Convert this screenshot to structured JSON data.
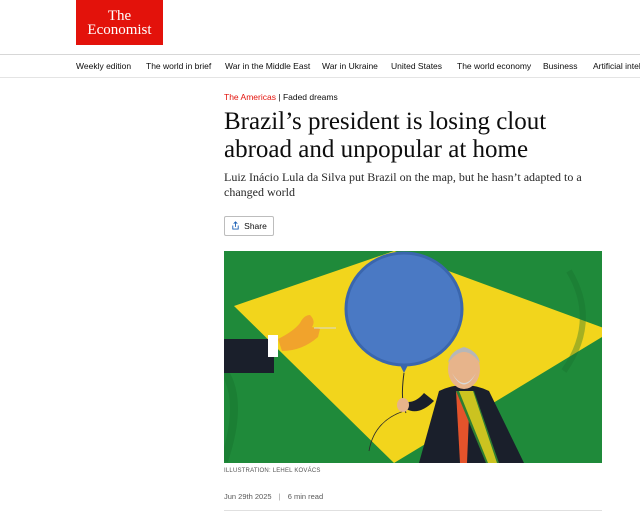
{
  "brand": {
    "line1": "The",
    "line2": "Economist",
    "color": "#e3120b"
  },
  "nav": {
    "items": [
      "Weekly edition",
      "The world in brief",
      "War in the Middle East",
      "War in Ukraine",
      "United States",
      "The world economy",
      "Business",
      "Artificial intel"
    ]
  },
  "article": {
    "section": "The Americas",
    "separator": "|",
    "fly_title": "Faded dreams",
    "headline": "Brazil’s president is losing clout abroad and unpopular at home",
    "subheadline": "Luiz Inácio Lula da Silva put Brazil on the map, but he hasn’t adapted to a changed world",
    "share_label": "Share",
    "share_icon": "share-icon",
    "image_caption": "ILLUSTRATION: LEHEL KOVÁCS",
    "date": "Jun 29th 2025",
    "meta_separator": "|",
    "read_time": "6 min read"
  },
  "colors": {
    "flag_green": "#1f8a3a",
    "flag_yellow": "#f2d51c",
    "balloon_blue": "#4a79c4"
  }
}
